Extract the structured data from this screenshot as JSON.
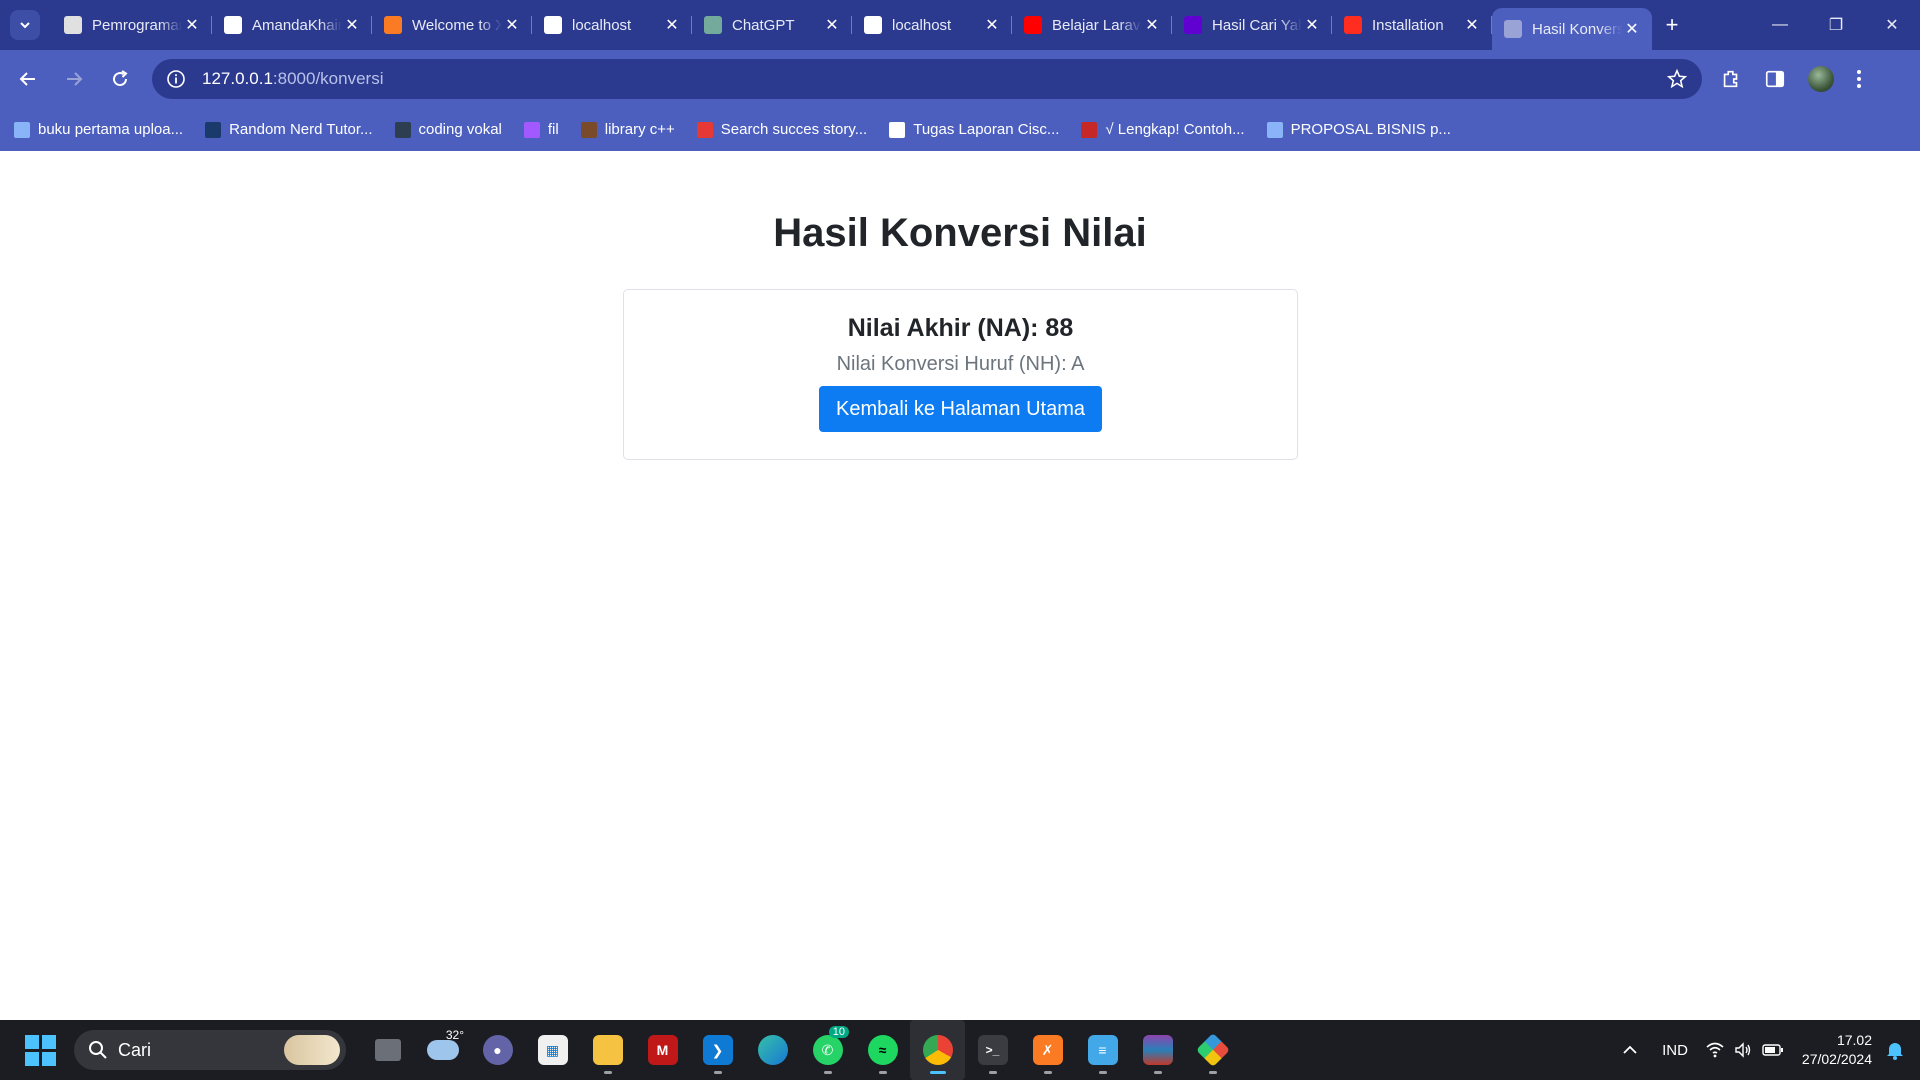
{
  "tabs": [
    {
      "label": "Pemrograman",
      "favicon": "person-card-icon",
      "color": "#e0e0e0",
      "active": false
    },
    {
      "label": "AmandaKhairunnisa",
      "favicon": "github-icon",
      "color": "#ffffff",
      "active": false
    },
    {
      "label": "Welcome to XAMPP",
      "favicon": "xampp-icon",
      "color": "#fb7a24",
      "active": false
    },
    {
      "label": "localhost",
      "favicon": "localhost-icon",
      "color": "#ffffff",
      "active": false
    },
    {
      "label": "ChatGPT",
      "favicon": "chatgpt-icon",
      "color": "#74aa9c",
      "active": false
    },
    {
      "label": "localhost",
      "favicon": "localhost-icon",
      "color": "#ffffff",
      "active": false
    },
    {
      "label": "Belajar Laravel",
      "favicon": "youtube-icon",
      "color": "#ff0000",
      "active": false
    },
    {
      "label": "Hasil Cari Yahoo",
      "favicon": "yahoo-icon",
      "color": "#6001d2",
      "active": false
    },
    {
      "label": "Installation",
      "favicon": "laravel-icon",
      "color": "#ff2d20",
      "active": false
    },
    {
      "label": "Hasil Konversi",
      "favicon": "globe-icon",
      "color": "#9aa3d6",
      "active": true
    }
  ],
  "address_bar": {
    "host": "127.0.0.1",
    "path": ":8000/konversi"
  },
  "bookmarks": [
    {
      "label": "buku pertama uploa...",
      "icon": "doc-icon",
      "color": "#8ab4f8"
    },
    {
      "label": "Random Nerd Tutor...",
      "icon": "r-icon",
      "color": "#1a3a6b"
    },
    {
      "label": "coding vokal",
      "icon": "dicoding-icon",
      "color": "#2d3e50"
    },
    {
      "label": "fil",
      "icon": "figma-icon",
      "color": "#a259ff"
    },
    {
      "label": "library c++",
      "icon": "person-icon",
      "color": "#7a4b2a"
    },
    {
      "label": "Search succes story...",
      "icon": "wps-icon",
      "color": "#e53935"
    },
    {
      "label": "Tugas Laporan Cisc...",
      "icon": "font-a-icon",
      "color": "#ffffff"
    },
    {
      "label": "√ Lengkap! Contoh...",
      "icon": "spiral-icon",
      "color": "#c62828"
    },
    {
      "label": "PROPOSAL BISNIS p...",
      "icon": "doc-icon",
      "color": "#8ab4f8"
    }
  ],
  "page": {
    "title": "Hasil Konversi Nilai",
    "nilai_akhir_label": "Nilai Akhir (NA): 88",
    "nilai_huruf_label": "Nilai Konversi Huruf (NH): A",
    "back_button": "Kembali ke Halaman Utama"
  },
  "taskbar": {
    "search_placeholder": "Cari",
    "weather_temp": "32°",
    "whatsapp_badge": "10",
    "language": "IND",
    "time": "17.02",
    "date": "27/02/2024"
  },
  "colors": {
    "accent_button": "#0d7cf2",
    "browser_frame": "#2b3a8f",
    "browser_toolbar": "#4c5fbf"
  }
}
